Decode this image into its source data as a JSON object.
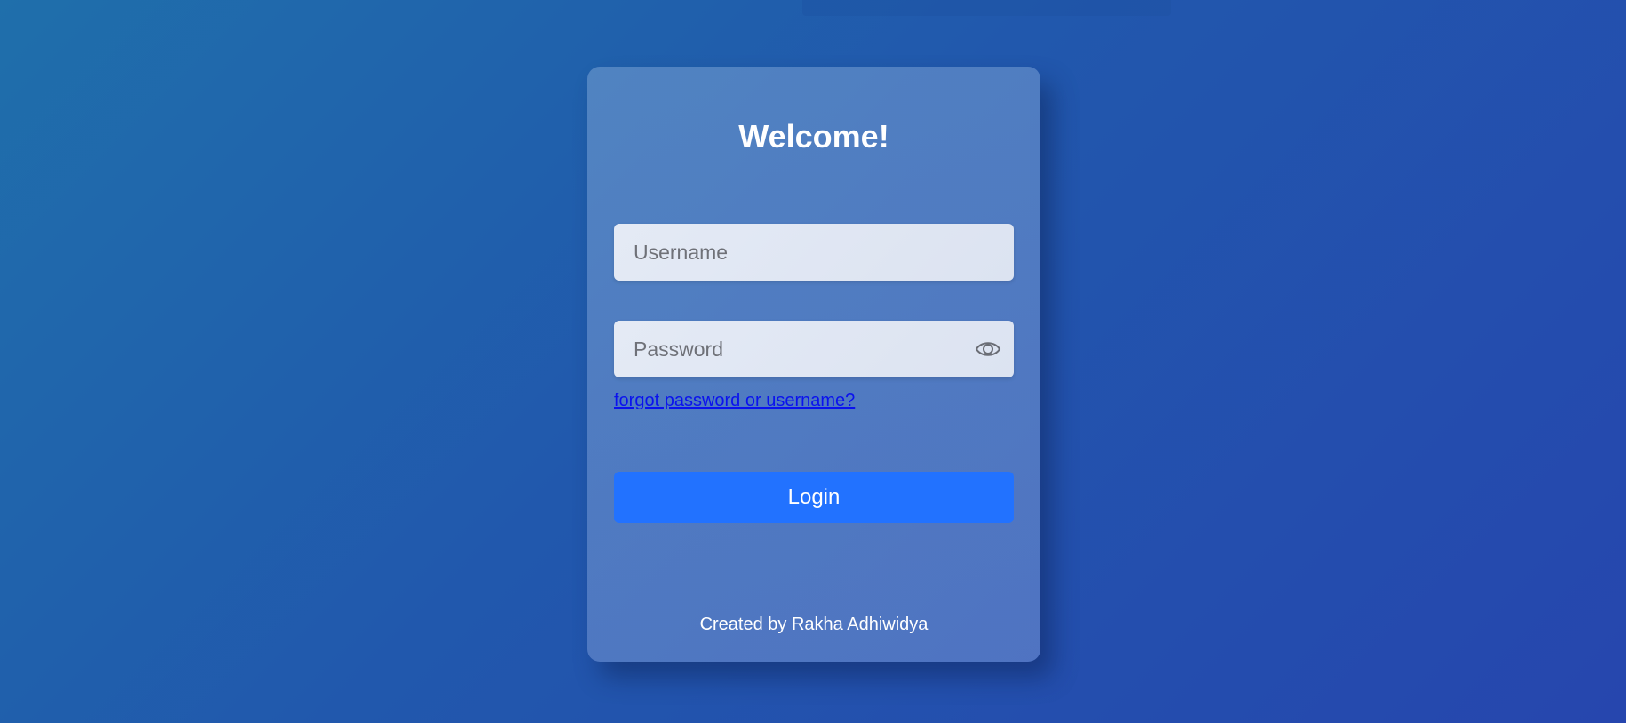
{
  "login_card": {
    "title": "Welcome!",
    "username": {
      "value": "",
      "placeholder": "Username"
    },
    "password": {
      "value": "",
      "placeholder": "Password",
      "toggle_icon": "eye-icon"
    },
    "forgot_link": "forgot password or username?",
    "login_button": "Login",
    "credit": "Created by Rakha Adhiwidya"
  },
  "colors": {
    "button": "#2272ff",
    "link": "#0a12ee",
    "background_start": "#1f6fab",
    "background_end": "#2646ae"
  }
}
